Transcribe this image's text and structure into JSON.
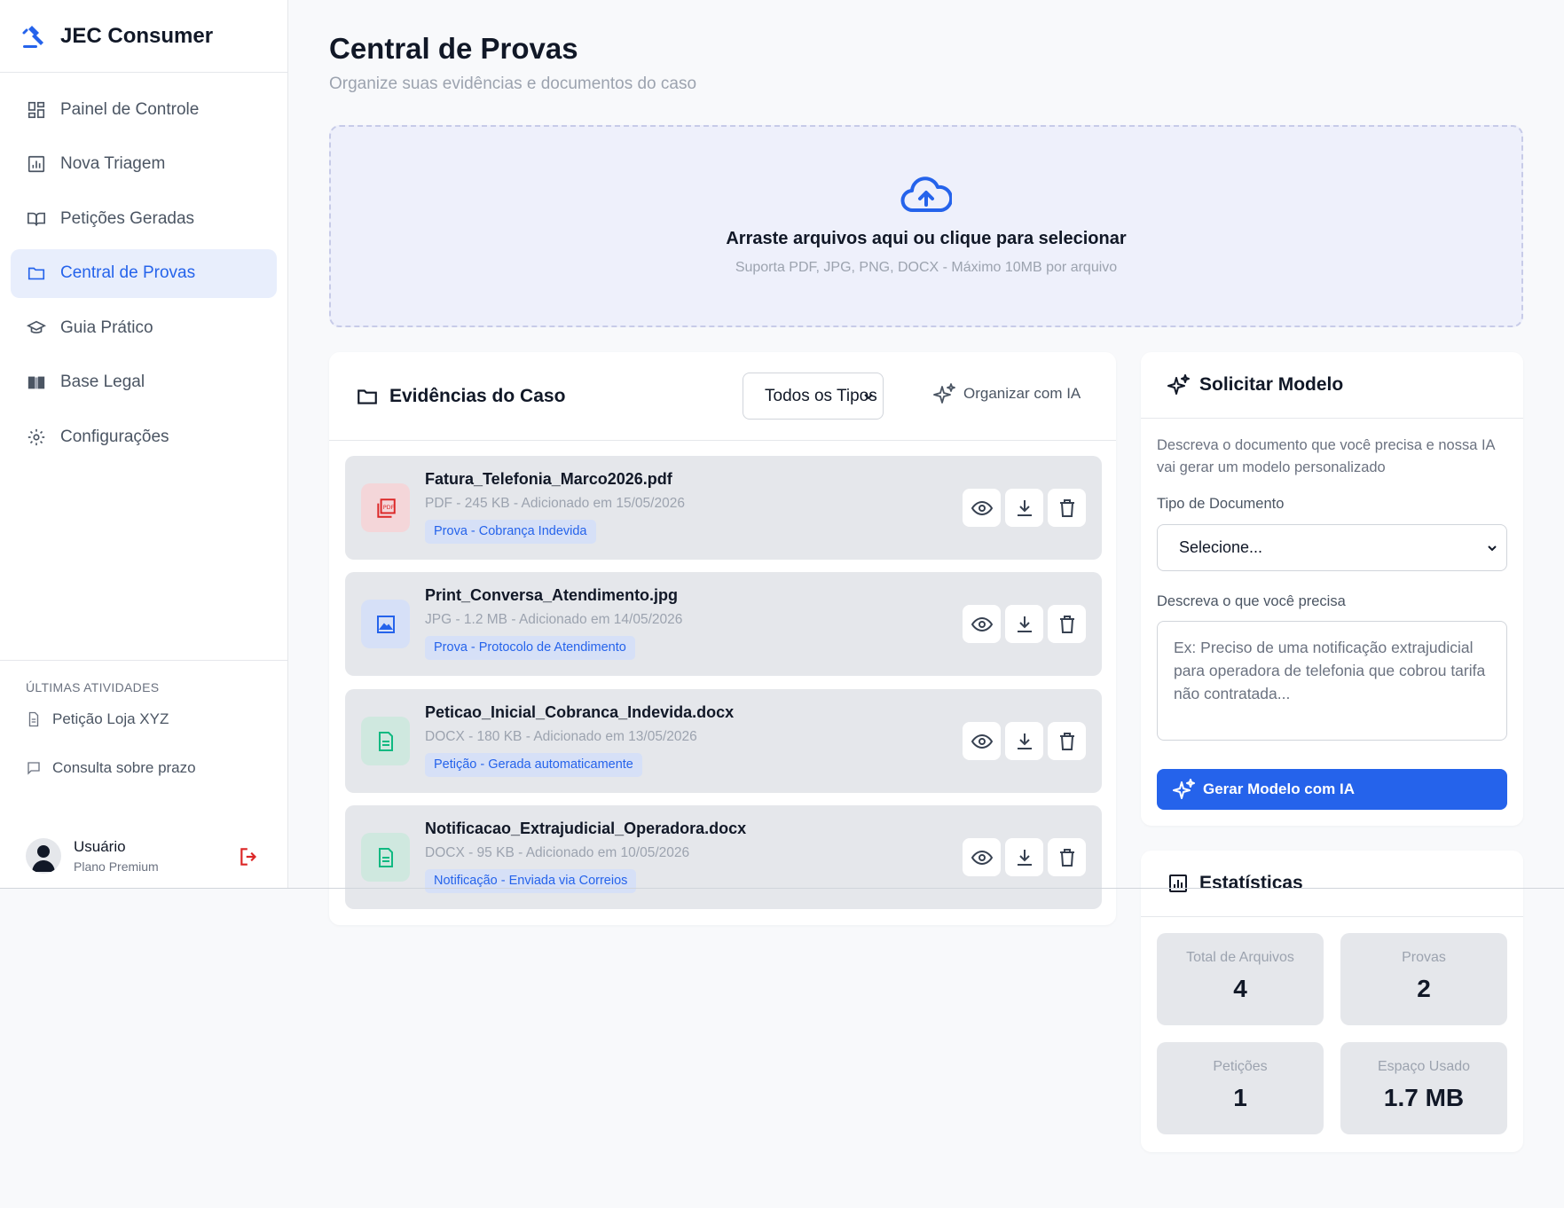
{
  "brand": {
    "name": "JEC Consumer"
  },
  "nav": [
    {
      "label": "Painel de Controle",
      "icon": "dashboard-icon"
    },
    {
      "label": "Nova Triagem",
      "icon": "chart-icon"
    },
    {
      "label": "Petições Geradas",
      "icon": "book-open-icon"
    },
    {
      "label": "Central de Provas",
      "icon": "folder-icon",
      "active": true
    },
    {
      "label": "Guia Prático",
      "icon": "graduation-cap-icon"
    },
    {
      "label": "Base Legal",
      "icon": "book-icon"
    },
    {
      "label": "Configurações",
      "icon": "gear-icon"
    }
  ],
  "activities": {
    "label": "ÚLTIMAS ATIVIDADES",
    "items": [
      {
        "label": "Petição Loja XYZ",
        "icon": "document-icon"
      },
      {
        "label": "Consulta sobre prazo",
        "icon": "chat-icon"
      }
    ]
  },
  "user": {
    "name": "Usuário",
    "plan": "Plano Premium"
  },
  "page": {
    "title": "Central de Provas",
    "subtitle": "Organize suas evidências e documentos do caso"
  },
  "upload": {
    "title": "Arraste arquivos aqui ou clique para selecionar",
    "hint": "Suporta PDF, JPG, PNG, DOCX - Máximo 10MB por arquivo"
  },
  "evidence": {
    "title": "Evidências do Caso",
    "filter": "Todos os Tipos",
    "organize_label": "Organizar com IA",
    "files": [
      {
        "name": "Fatura_Telefonia_Marco2026.pdf",
        "meta": "PDF - 245 KB - Adicionado em 15/05/2026",
        "tag": "Prova - Cobrança Indevida",
        "type": "pdf"
      },
      {
        "name": "Print_Conversa_Atendimento.jpg",
        "meta": "JPG - 1.2 MB - Adicionado em 14/05/2026",
        "tag": "Prova - Protocolo de Atendimento",
        "type": "image"
      },
      {
        "name": "Peticao_Inicial_Cobranca_Indevida.docx",
        "meta": "DOCX - 180 KB - Adicionado em 13/05/2026",
        "tag": "Petição - Gerada automaticamente",
        "type": "doc"
      },
      {
        "name": "Notificacao_Extrajudicial_Operadora.docx",
        "meta": "DOCX - 95 KB - Adicionado em 10/05/2026",
        "tag": "Notificação - Enviada via Correios",
        "type": "doc"
      }
    ]
  },
  "request": {
    "title": "Solicitar Modelo",
    "description": "Descreva o documento que você precisa e nossa IA vai gerar um modelo personalizado",
    "doc_type_label": "Tipo de Documento",
    "doc_type_value": "Selecione...",
    "need_label": "Descreva o que você precisa",
    "need_placeholder": "Ex: Preciso de uma notificação extrajudicial para operadora de telefonia que cobrou tarifa não contratada...",
    "button": "Gerar Modelo com IA"
  },
  "stats": {
    "title": "Estatísticas",
    "items": [
      {
        "label": "Total de Arquivos",
        "value": "4"
      },
      {
        "label": "Provas",
        "value": "2"
      },
      {
        "label": "Petições",
        "value": "1"
      },
      {
        "label": "Espaço Usado",
        "value": "1.7 MB"
      }
    ]
  },
  "colors": {
    "accent": "#2563eb",
    "danger": "#dc2626",
    "success": "#10b981"
  }
}
